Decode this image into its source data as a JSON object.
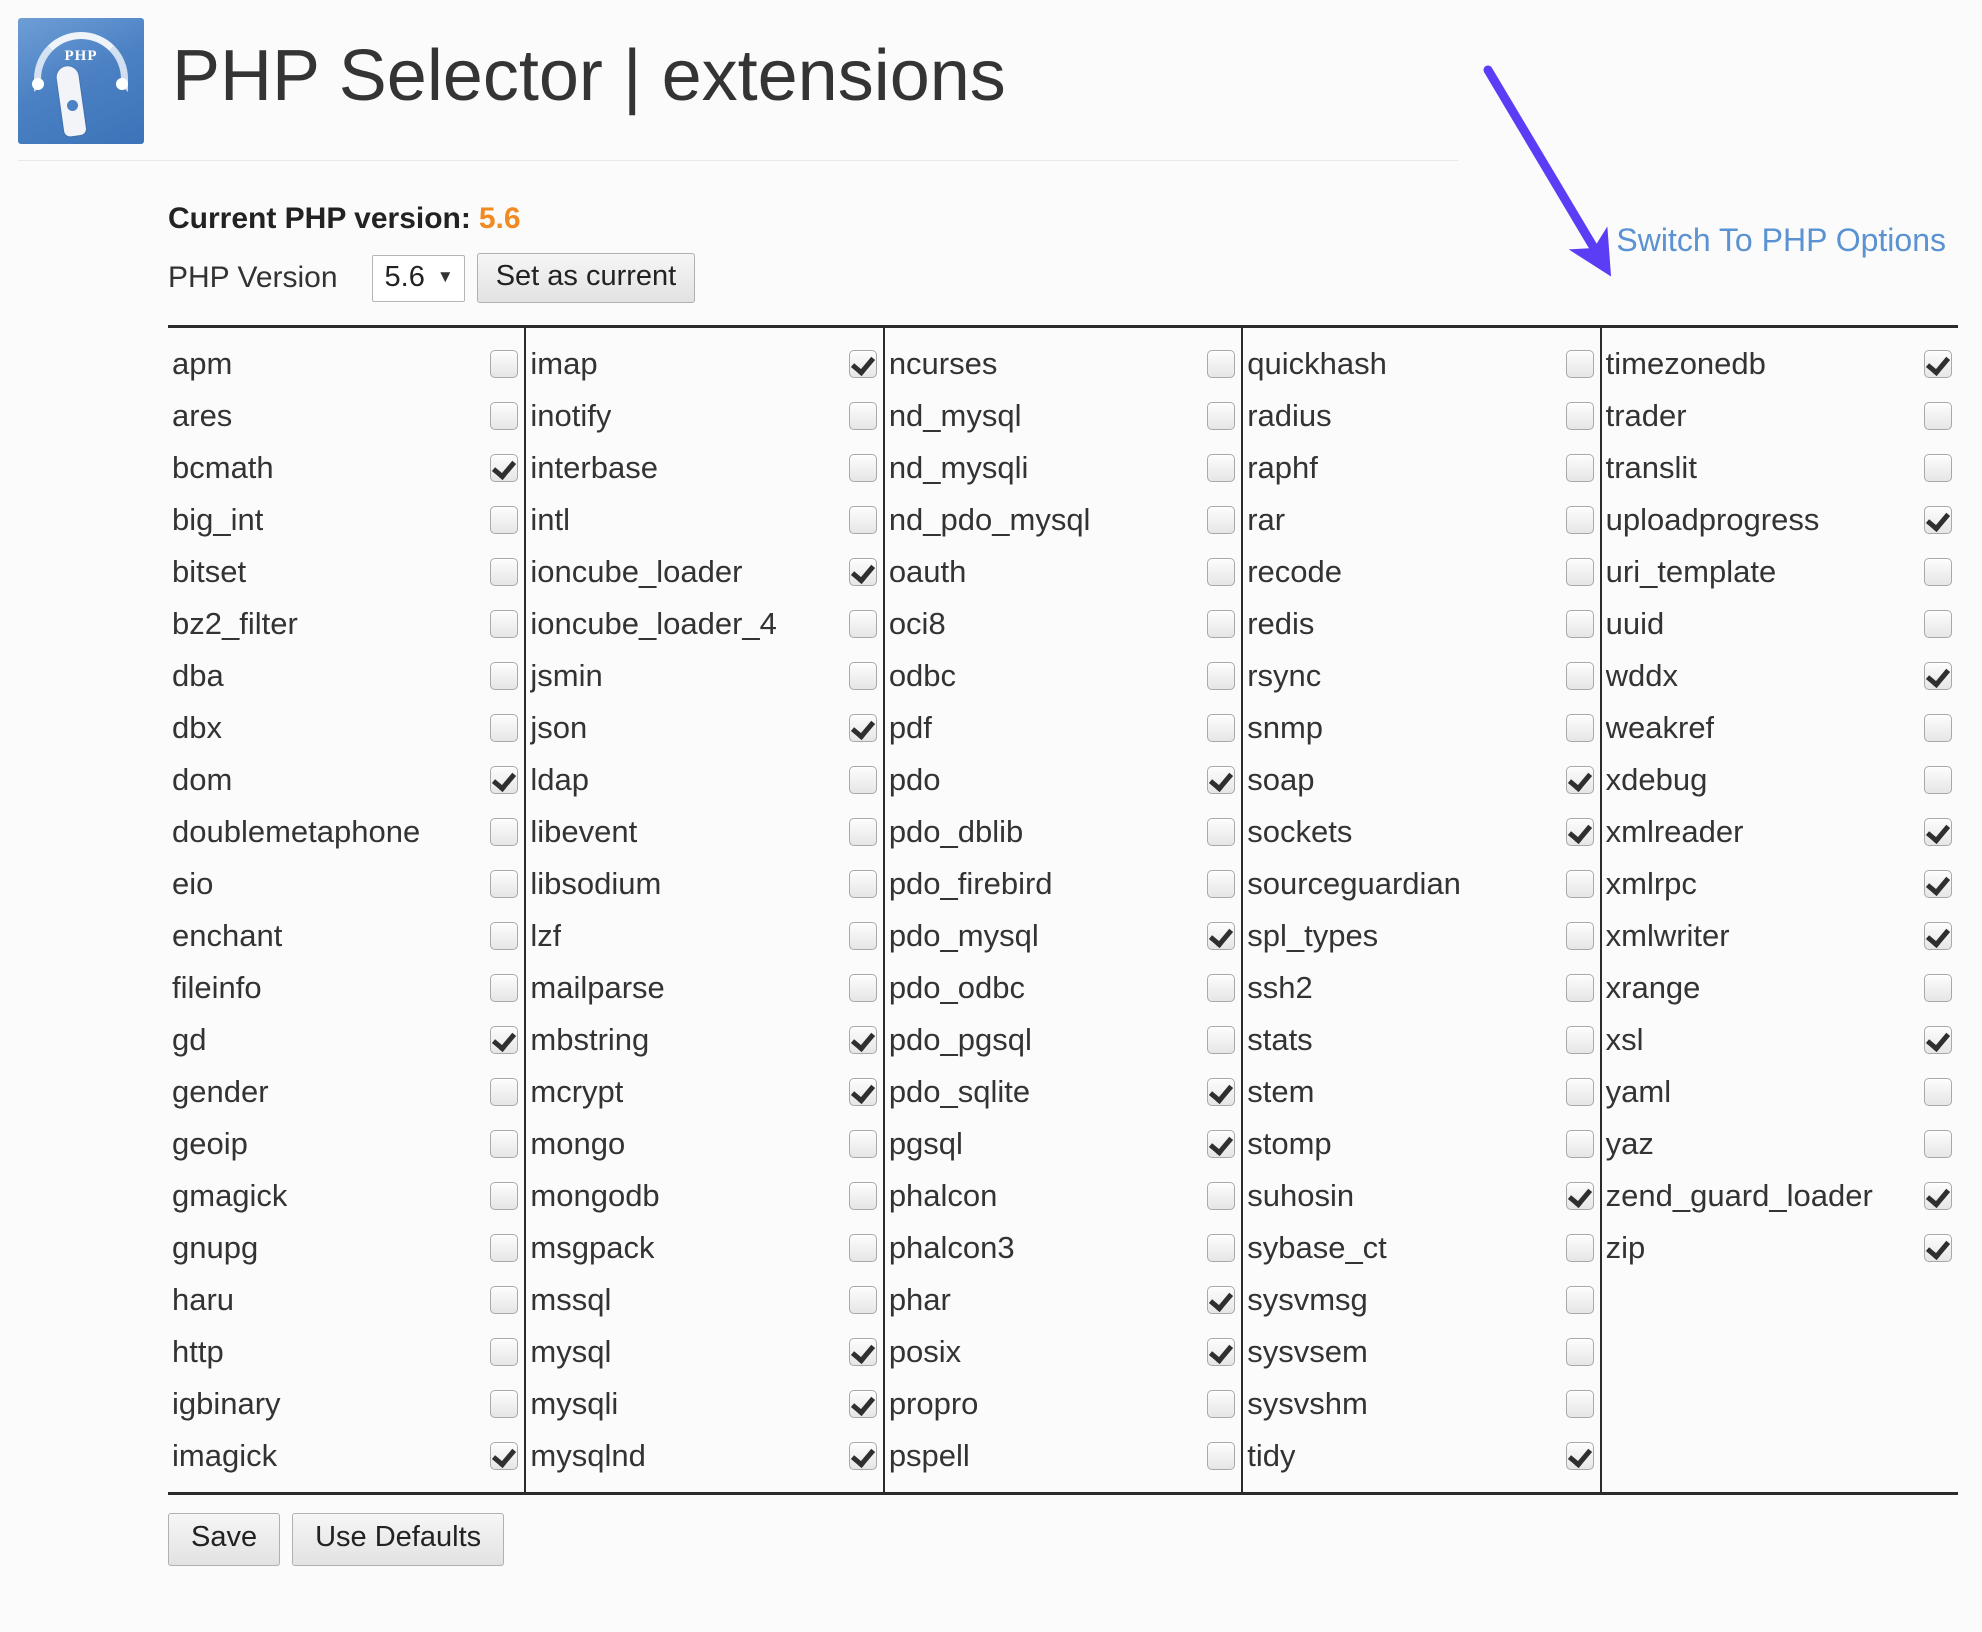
{
  "header": {
    "logo_icon": "php-gauge-logo",
    "logo_text": "PHP",
    "title": "PHP Selector | extensions"
  },
  "version": {
    "current_label": "Current PHP version:",
    "current_value": "5.6",
    "current_value_color": "#f28a22",
    "select_label": "PHP Version",
    "selected_version": "5.6",
    "caret_icon": "chevron-down-icon",
    "set_button_label": "Set as current",
    "switch_link_label": "Switch To PHP Options",
    "switch_link_color": "#5b92d2"
  },
  "annotation": {
    "arrow_icon": "arrow-down-right-icon",
    "arrow_color": "#5b3df5"
  },
  "footer": {
    "save_label": "Save",
    "defaults_label": "Use Defaults"
  },
  "extensions": {
    "columns": [
      [
        {
          "name": "apm",
          "checked": false
        },
        {
          "name": "ares",
          "checked": false
        },
        {
          "name": "bcmath",
          "checked": true
        },
        {
          "name": "big_int",
          "checked": false
        },
        {
          "name": "bitset",
          "checked": false
        },
        {
          "name": "bz2_filter",
          "checked": false
        },
        {
          "name": "dba",
          "checked": false
        },
        {
          "name": "dbx",
          "checked": false
        },
        {
          "name": "dom",
          "checked": true
        },
        {
          "name": "doublemetaphone",
          "checked": false
        },
        {
          "name": "eio",
          "checked": false
        },
        {
          "name": "enchant",
          "checked": false
        },
        {
          "name": "fileinfo",
          "checked": false
        },
        {
          "name": "gd",
          "checked": true
        },
        {
          "name": "gender",
          "checked": false
        },
        {
          "name": "geoip",
          "checked": false
        },
        {
          "name": "gmagick",
          "checked": false
        },
        {
          "name": "gnupg",
          "checked": false
        },
        {
          "name": "haru",
          "checked": false
        },
        {
          "name": "http",
          "checked": false
        },
        {
          "name": "igbinary",
          "checked": false
        },
        {
          "name": "imagick",
          "checked": true
        }
      ],
      [
        {
          "name": "imap",
          "checked": true
        },
        {
          "name": "inotify",
          "checked": false
        },
        {
          "name": "interbase",
          "checked": false
        },
        {
          "name": "intl",
          "checked": false
        },
        {
          "name": "ioncube_loader",
          "checked": true
        },
        {
          "name": "ioncube_loader_4",
          "checked": false
        },
        {
          "name": "jsmin",
          "checked": false
        },
        {
          "name": "json",
          "checked": true
        },
        {
          "name": "ldap",
          "checked": false
        },
        {
          "name": "libevent",
          "checked": false
        },
        {
          "name": "libsodium",
          "checked": false
        },
        {
          "name": "lzf",
          "checked": false
        },
        {
          "name": "mailparse",
          "checked": false
        },
        {
          "name": "mbstring",
          "checked": true
        },
        {
          "name": "mcrypt",
          "checked": true
        },
        {
          "name": "mongo",
          "checked": false
        },
        {
          "name": "mongodb",
          "checked": false
        },
        {
          "name": "msgpack",
          "checked": false
        },
        {
          "name": "mssql",
          "checked": false
        },
        {
          "name": "mysql",
          "checked": true
        },
        {
          "name": "mysqli",
          "checked": true
        },
        {
          "name": "mysqlnd",
          "checked": true
        }
      ],
      [
        {
          "name": "ncurses",
          "checked": false
        },
        {
          "name": "nd_mysql",
          "checked": false
        },
        {
          "name": "nd_mysqli",
          "checked": false
        },
        {
          "name": "nd_pdo_mysql",
          "checked": false
        },
        {
          "name": "oauth",
          "checked": false
        },
        {
          "name": "oci8",
          "checked": false
        },
        {
          "name": "odbc",
          "checked": false
        },
        {
          "name": "pdf",
          "checked": false
        },
        {
          "name": "pdo",
          "checked": true
        },
        {
          "name": "pdo_dblib",
          "checked": false
        },
        {
          "name": "pdo_firebird",
          "checked": false
        },
        {
          "name": "pdo_mysql",
          "checked": true
        },
        {
          "name": "pdo_odbc",
          "checked": false
        },
        {
          "name": "pdo_pgsql",
          "checked": false
        },
        {
          "name": "pdo_sqlite",
          "checked": true
        },
        {
          "name": "pgsql",
          "checked": true
        },
        {
          "name": "phalcon",
          "checked": false
        },
        {
          "name": "phalcon3",
          "checked": false
        },
        {
          "name": "phar",
          "checked": true
        },
        {
          "name": "posix",
          "checked": true
        },
        {
          "name": "propro",
          "checked": false
        },
        {
          "name": "pspell",
          "checked": false
        }
      ],
      [
        {
          "name": "quickhash",
          "checked": false
        },
        {
          "name": "radius",
          "checked": false
        },
        {
          "name": "raphf",
          "checked": false
        },
        {
          "name": "rar",
          "checked": false
        },
        {
          "name": "recode",
          "checked": false
        },
        {
          "name": "redis",
          "checked": false
        },
        {
          "name": "rsync",
          "checked": false
        },
        {
          "name": "snmp",
          "checked": false
        },
        {
          "name": "soap",
          "checked": true
        },
        {
          "name": "sockets",
          "checked": true
        },
        {
          "name": "sourceguardian",
          "checked": false
        },
        {
          "name": "spl_types",
          "checked": false
        },
        {
          "name": "ssh2",
          "checked": false
        },
        {
          "name": "stats",
          "checked": false
        },
        {
          "name": "stem",
          "checked": false
        },
        {
          "name": "stomp",
          "checked": false
        },
        {
          "name": "suhosin",
          "checked": true
        },
        {
          "name": "sybase_ct",
          "checked": false
        },
        {
          "name": "sysvmsg",
          "checked": false
        },
        {
          "name": "sysvsem",
          "checked": false
        },
        {
          "name": "sysvshm",
          "checked": false
        },
        {
          "name": "tidy",
          "checked": true
        }
      ],
      [
        {
          "name": "timezonedb",
          "checked": true
        },
        {
          "name": "trader",
          "checked": false
        },
        {
          "name": "translit",
          "checked": false
        },
        {
          "name": "uploadprogress",
          "checked": true
        },
        {
          "name": "uri_template",
          "checked": false
        },
        {
          "name": "uuid",
          "checked": false
        },
        {
          "name": "wddx",
          "checked": true
        },
        {
          "name": "weakref",
          "checked": false
        },
        {
          "name": "xdebug",
          "checked": false
        },
        {
          "name": "xmlreader",
          "checked": true
        },
        {
          "name": "xmlrpc",
          "checked": true
        },
        {
          "name": "xmlwriter",
          "checked": true
        },
        {
          "name": "xrange",
          "checked": false
        },
        {
          "name": "xsl",
          "checked": true
        },
        {
          "name": "yaml",
          "checked": false
        },
        {
          "name": "yaz",
          "checked": false
        },
        {
          "name": "zend_guard_loader",
          "checked": true
        },
        {
          "name": "zip",
          "checked": true
        }
      ]
    ]
  }
}
